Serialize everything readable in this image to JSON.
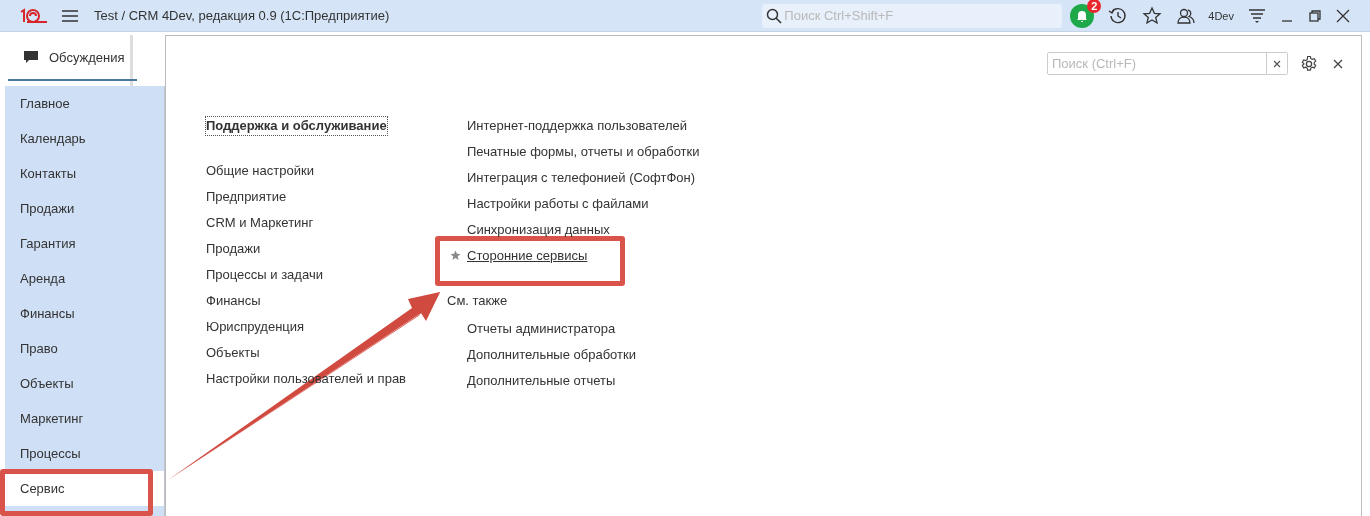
{
  "window": {
    "title": "Test / CRM 4Dev, редакция 0.9  (1С:Предприятие)",
    "search_placeholder": "Поиск Ctrl+Shift+F",
    "notifications": "2",
    "user": "4Dev"
  },
  "side_tab": {
    "label": "Обсуждения",
    "selected": true
  },
  "sidebar": {
    "items": [
      {
        "label": "Главное",
        "selected": false,
        "highlighted": false
      },
      {
        "label": "Календарь",
        "selected": false,
        "highlighted": false
      },
      {
        "label": "Контакты",
        "selected": false,
        "highlighted": false
      },
      {
        "label": "Продажи",
        "selected": false,
        "highlighted": false
      },
      {
        "label": "Гарантия",
        "selected": false,
        "highlighted": false
      },
      {
        "label": "Аренда",
        "selected": false,
        "highlighted": false
      },
      {
        "label": "Финансы",
        "selected": false,
        "highlighted": false
      },
      {
        "label": "Право",
        "selected": false,
        "highlighted": false
      },
      {
        "label": "Объекты",
        "selected": false,
        "highlighted": false
      },
      {
        "label": "Маркетинг",
        "selected": false,
        "highlighted": false
      },
      {
        "label": "Процессы",
        "selected": false,
        "highlighted": false
      },
      {
        "label": "Сервис",
        "selected": true,
        "highlighted": true
      }
    ]
  },
  "panel": {
    "search_placeholder": "Поиск (Ctrl+F)",
    "groups": [
      {
        "label": "Поддержка и обслуживание",
        "selected": true
      },
      {
        "label": "Общие настройки",
        "selected": false
      },
      {
        "label": "Предприятие",
        "selected": false
      },
      {
        "label": "CRM и Маркетинг",
        "selected": false
      },
      {
        "label": "Продажи",
        "selected": false
      },
      {
        "label": "Процессы и задачи",
        "selected": false
      },
      {
        "label": "Финансы",
        "selected": false
      },
      {
        "label": "Юриспруденция",
        "selected": false
      },
      {
        "label": "Объекты",
        "selected": false
      },
      {
        "label": "Настройки пользователей и прав",
        "selected": false
      }
    ],
    "commands": [
      {
        "label": "Интернет-поддержка пользователей",
        "favorite": false,
        "highlighted": false
      },
      {
        "label": "Печатные формы, отчеты и обработки",
        "favorite": false,
        "highlighted": false
      },
      {
        "label": "Интеграция с телефонией (СофтФон)",
        "favorite": false,
        "highlighted": false
      },
      {
        "label": "Настройки работы с файлами",
        "favorite": false,
        "highlighted": false
      },
      {
        "label": "Синхронизация данных",
        "favorite": false,
        "highlighted": false
      },
      {
        "label": "Сторонние сервисы",
        "favorite": true,
        "highlighted": true
      }
    ],
    "see_also": {
      "title": "См. также",
      "items": [
        "Отчеты администратора",
        "Дополнительные обработки",
        "Дополнительные отчеты"
      ]
    }
  },
  "callout_arrow": true
}
